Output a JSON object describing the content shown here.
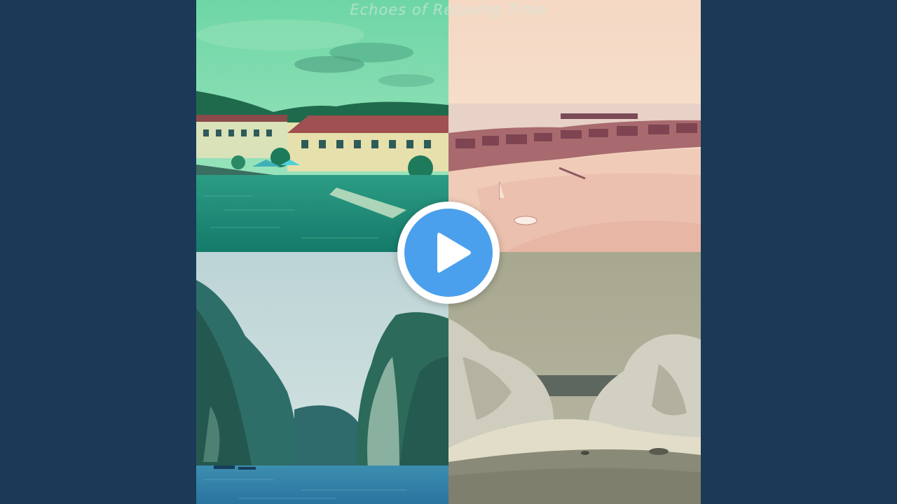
{
  "cover": {
    "title": "Echoes of Relaxing Time",
    "tiles": [
      {
        "scene": "harbor-town",
        "tint": "#3fb8a0"
      },
      {
        "scene": "beach-resort",
        "tint": "#e8c8b8"
      },
      {
        "scene": "limestone-cliffs-bay",
        "tint": "#5a9cb0"
      },
      {
        "scene": "rocky-cove-beach",
        "tint": "#b8b8a4"
      }
    ]
  },
  "player": {
    "play_icon": "play-icon",
    "accent": "#4aa0ec",
    "background": "#1b3a57"
  }
}
